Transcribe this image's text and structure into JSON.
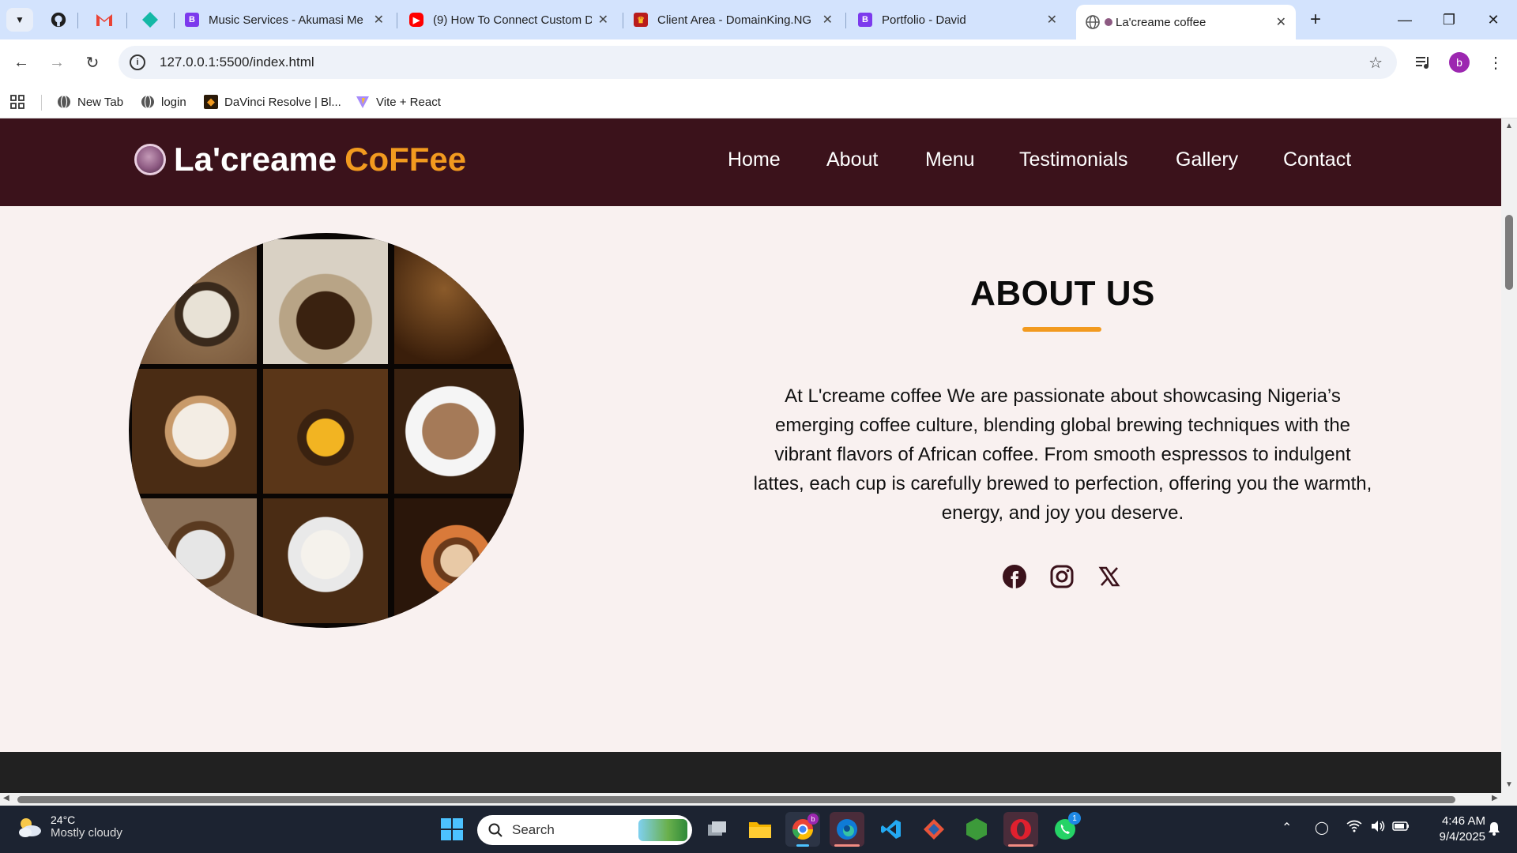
{
  "browser": {
    "tabs": [
      {
        "title": "Music Services - Akumasi Me",
        "favicon": "B"
      },
      {
        "title": "(9) How To Connect Custom D",
        "favicon": "youtube"
      },
      {
        "title": "Client Area - DomainKing.NG",
        "favicon": "crown"
      },
      {
        "title": "Portfolio - David",
        "favicon": "B"
      },
      {
        "title": "La'creame coffee",
        "favicon": "coffee"
      }
    ],
    "url": "127.0.0.1:5500/index.html",
    "profile_initial": "b",
    "bookmarks": [
      {
        "label": "New Tab"
      },
      {
        "label": "login"
      },
      {
        "label": "DaVinci Resolve | Bl..."
      },
      {
        "label": "Vite + React"
      }
    ]
  },
  "site": {
    "logo_main": "La'creame",
    "logo_accent": "CoFFee",
    "nav": [
      "Home",
      "About",
      "Menu",
      "Testimonials",
      "Gallery",
      "Contact"
    ],
    "about_title": "ABOUT US",
    "about_text": "At L'creame coffee We are passionate about showcasing Nigeria’s emerging coffee culture, blending global brewing techniques with the vibrant flavors of African coffee. From smooth espressos to indulgent lattes, each cup is carefully brewed to perfection, offering you the warmth, energy, and joy you deserve.",
    "social": [
      "facebook-icon",
      "instagram-icon",
      "x-icon"
    ],
    "colors": {
      "nav_bg": "#3b121b",
      "accent": "#f29a1f",
      "page_bg": "#f9f1f0"
    }
  },
  "taskbar": {
    "temperature": "24°C",
    "weather": "Mostly cloudy",
    "search_placeholder": "Search",
    "whatsapp_badge": "1",
    "time": "4:46 AM",
    "date": "9/4/2025"
  }
}
